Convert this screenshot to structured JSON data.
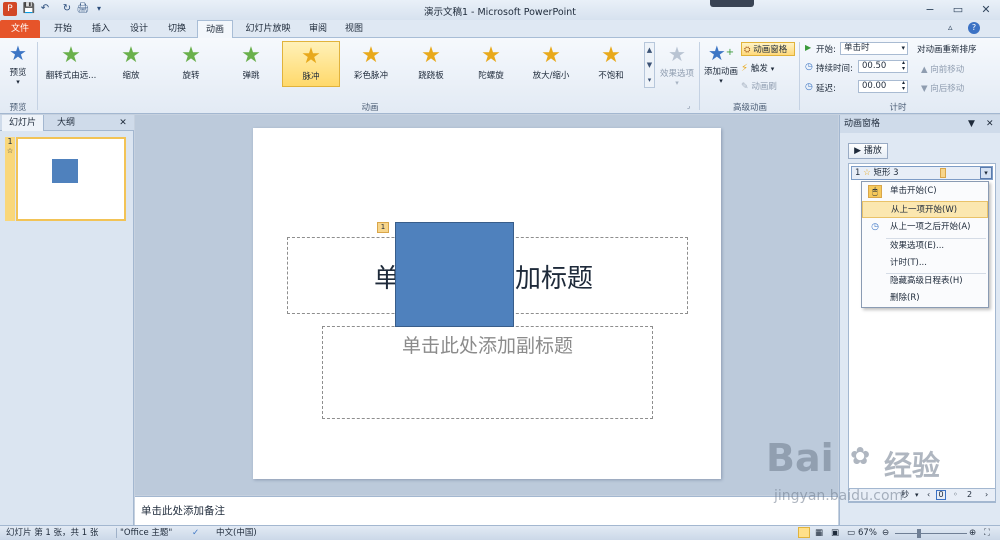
{
  "titlebar": {
    "title": "演示文稿1 - Microsoft PowerPoint",
    "save_icon": "save-icon",
    "undo_icon": "undo-icon",
    "redo_icon": "redo-icon",
    "print_icon": "print-preview-icon",
    "min": "−",
    "max": "▭",
    "close": "✕"
  },
  "tabs": [
    "文件",
    "开始",
    "插入",
    "设计",
    "切换",
    "动画",
    "幻灯片放映",
    "审阅",
    "视图"
  ],
  "ribbon": {
    "preview": {
      "label": "预览",
      "group_label": "预览"
    },
    "effects": [
      {
        "label": "翻转式由远...",
        "color": "#6ab04c"
      },
      {
        "label": "缩放",
        "color": "#6ab04c"
      },
      {
        "label": "旋转",
        "color": "#6ab04c"
      },
      {
        "label": "弹跳",
        "color": "#6ab04c"
      },
      {
        "label": "脉冲",
        "color": "#e8a91c"
      },
      {
        "label": "彩色脉冲",
        "color": "#e8a91c"
      },
      {
        "label": "跷跷板",
        "color": "#e8a91c"
      },
      {
        "label": "陀螺旋",
        "color": "#e8a91c"
      },
      {
        "label": "放大/缩小",
        "color": "#e8a91c"
      },
      {
        "label": "不饱和",
        "color": "#e8a91c"
      }
    ],
    "effect_options": "效果选项",
    "anim_group_label": "动画",
    "add_animation": "添加动画",
    "anim_pane": "动画窗格",
    "trigger": "触发",
    "anim_painter": "动画刷",
    "adv_group_label": "高级动画",
    "start_label": "开始:",
    "start_value": "单击时",
    "duration_label": "持续时间:",
    "duration_value": "00.50",
    "delay_label": "延迟:",
    "delay_value": "00.00",
    "reorder_label": "对动画重新排序",
    "move_earlier": "向前移动",
    "move_later": "向后移动",
    "timing_group_label": "计时"
  },
  "leftpane": {
    "tab_slides": "幻灯片",
    "tab_outline": "大纲",
    "close": "✕",
    "slide_num": "1"
  },
  "slide": {
    "title_left": "单",
    "title_right": "加标题",
    "subtitle": "单击此处添加副标题",
    "anim_tag": "1",
    "shape_color": "#4f81bd"
  },
  "notes": {
    "placeholder": "单击此处添加备注"
  },
  "animpane": {
    "title": "动画窗格",
    "play": "播放",
    "item": {
      "num": "1",
      "name": "矩形 3"
    },
    "menu": [
      {
        "label": "单击开始(C)",
        "icon": "mouse-click-icon"
      },
      {
        "label": "从上一项开始(W)",
        "icon": "",
        "highlighted": true
      },
      {
        "label": "从上一项之后开始(A)",
        "icon": "clock-icon"
      },
      {
        "label": "效果选项(E)...",
        "icon": ""
      },
      {
        "label": "计时(T)...",
        "icon": ""
      },
      {
        "label": "隐藏高级日程表(H)",
        "icon": ""
      },
      {
        "label": "删除(R)",
        "icon": ""
      }
    ],
    "seconds_label": "秒",
    "timeline_0": "0",
    "timeline_2": "2"
  },
  "status": {
    "slide_info": "幻灯片 第 1 张，共 1 张",
    "theme": "\"Office 主题\"",
    "language": "中文(中国)",
    "zoom": "67%"
  },
  "watermark": {
    "brand": "Bai",
    "brand2": "经验",
    "url": "jingyan.baidu.com"
  }
}
